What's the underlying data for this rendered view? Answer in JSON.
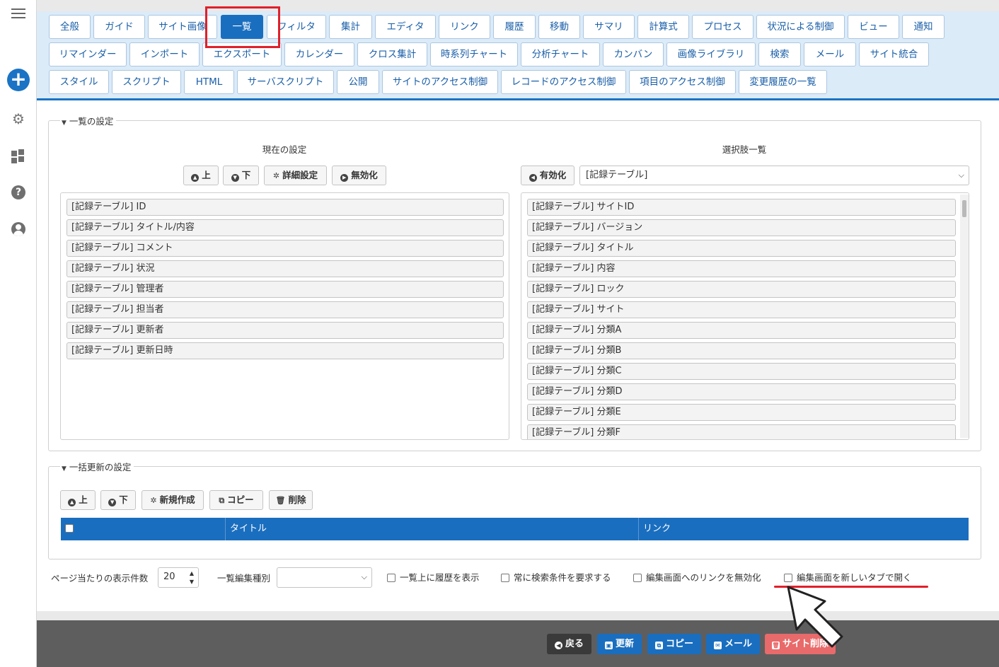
{
  "tabs": [
    {
      "label": "全般"
    },
    {
      "label": "ガイド"
    },
    {
      "label": "サイト画像"
    },
    {
      "label": "一覧"
    },
    {
      "label": "フィルタ"
    },
    {
      "label": "集計"
    },
    {
      "label": "エディタ"
    },
    {
      "label": "リンク"
    },
    {
      "label": "履歴"
    },
    {
      "label": "移動"
    },
    {
      "label": "サマリ"
    },
    {
      "label": "計算式"
    },
    {
      "label": "プロセス"
    },
    {
      "label": "状況による制御"
    },
    {
      "label": "ビュー"
    },
    {
      "label": "通知"
    },
    {
      "label": "リマインダー"
    },
    {
      "label": "インポート"
    },
    {
      "label": "エクスポート"
    },
    {
      "label": "カレンダー"
    },
    {
      "label": "クロス集計"
    },
    {
      "label": "時系列チャート"
    },
    {
      "label": "分析チャート"
    },
    {
      "label": "カンバン"
    },
    {
      "label": "画像ライブラリ"
    },
    {
      "label": "検索"
    },
    {
      "label": "メール"
    },
    {
      "label": "サイト統合"
    },
    {
      "label": "スタイル"
    },
    {
      "label": "スクリプト"
    },
    {
      "label": "HTML"
    },
    {
      "label": "サーバスクリプト"
    },
    {
      "label": "公開"
    },
    {
      "label": "サイトのアクセス制御"
    },
    {
      "label": "レコードのアクセス制御"
    },
    {
      "label": "項目のアクセス制御"
    },
    {
      "label": "変更履歴の一覧"
    }
  ],
  "list_settings": {
    "legend": "一覧の設定",
    "current_title": "現在の設定",
    "choices_title": "選択肢一覧",
    "btn_up": "上",
    "btn_down": "下",
    "btn_detail": "詳細設定",
    "btn_disable": "無効化",
    "btn_enable": "有効化",
    "table_select_value": "[記録テーブル]",
    "current_items": [
      "[記録テーブル] ID",
      "[記録テーブル] タイトル/内容",
      "[記録テーブル] コメント",
      "[記録テーブル] 状況",
      "[記録テーブル] 管理者",
      "[記録テーブル] 担当者",
      "[記録テーブル] 更新者",
      "[記録テーブル] 更新日時"
    ],
    "choice_items": [
      "[記録テーブル] サイトID",
      "[記録テーブル] バージョン",
      "[記録テーブル] タイトル",
      "[記録テーブル] 内容",
      "[記録テーブル] ロック",
      "[記録テーブル] サイト",
      "[記録テーブル] 分類A",
      "[記録テーブル] 分類B",
      "[記録テーブル] 分類C",
      "[記録テーブル] 分類D",
      "[記録テーブル] 分類E",
      "[記録テーブル] 分類F"
    ]
  },
  "bulk_update": {
    "legend": "一括更新の設定",
    "btn_up": "上",
    "btn_down": "下",
    "btn_new": "新規作成",
    "btn_copy": "コピー",
    "btn_delete": "削除",
    "col_title": "タイトル",
    "col_link": "リンク"
  },
  "options": {
    "page_size_label": "ページ当たりの表示件数",
    "page_size_value": "20",
    "edit_type_label": "一覧編集種別",
    "edit_type_value": "",
    "show_history": "一覧上に履歴を表示",
    "require_search": "常に検索条件を要求する",
    "disable_edit_link": "編集画面へのリンクを無効化",
    "open_new_tab": "編集画面を新しいタブで開く"
  },
  "footer": {
    "back": "戻る",
    "update": "更新",
    "copy": "コピー",
    "mail": "メール",
    "delete_site": "サイト削除"
  },
  "colors": {
    "accent": "#1a6ebf",
    "highlight": "#e0202a",
    "danger": "#e96a6a"
  }
}
